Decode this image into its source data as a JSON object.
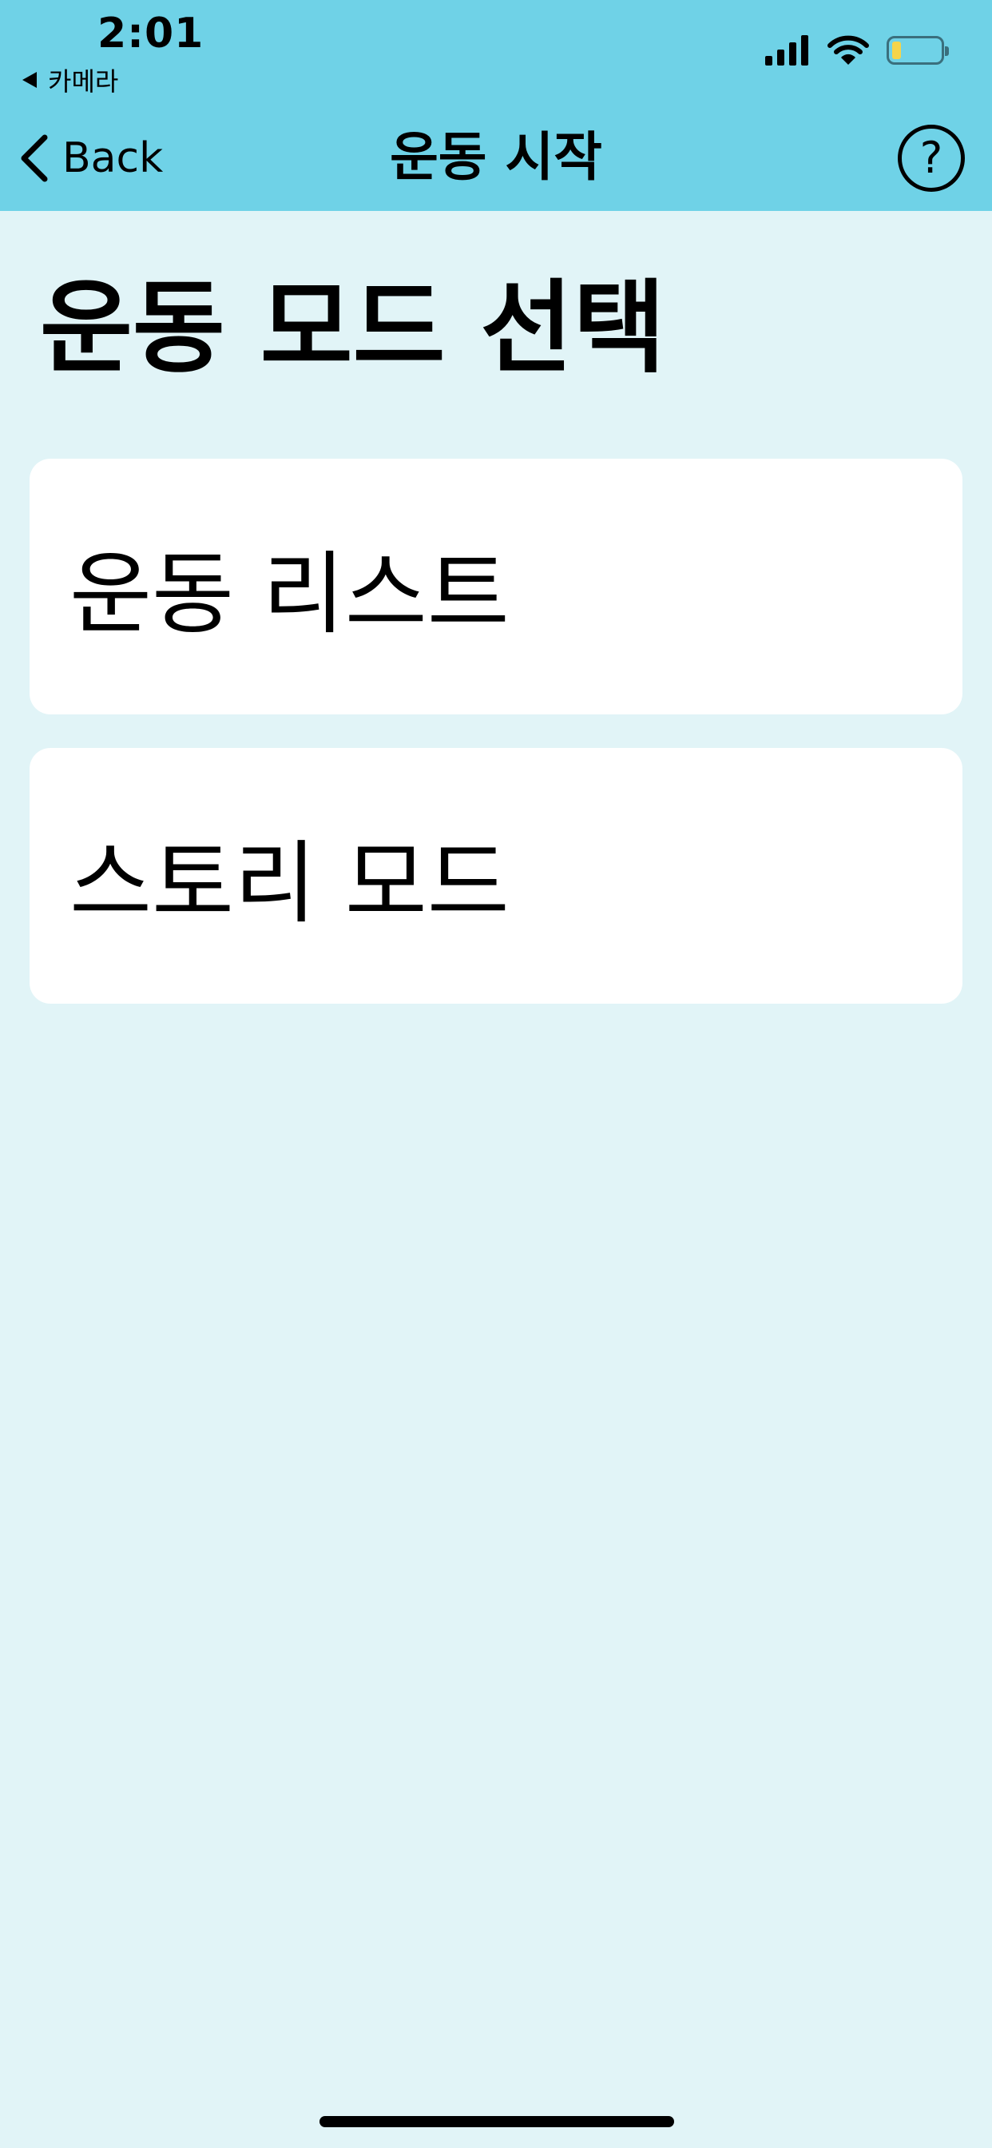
{
  "status_bar": {
    "time": "2:01",
    "back_app": "카메라",
    "battery_color": "#f5d44a"
  },
  "nav": {
    "back_label": "Back",
    "title": "운동 시작",
    "help_label": "?"
  },
  "page": {
    "title": "운동 모드 선택"
  },
  "modes": [
    {
      "label": "운동 리스트"
    },
    {
      "label": "스토리 모드"
    }
  ],
  "colors": {
    "header_bg": "#6fd2e7",
    "page_bg": "#e1f4f7",
    "card_bg": "#ffffff"
  }
}
